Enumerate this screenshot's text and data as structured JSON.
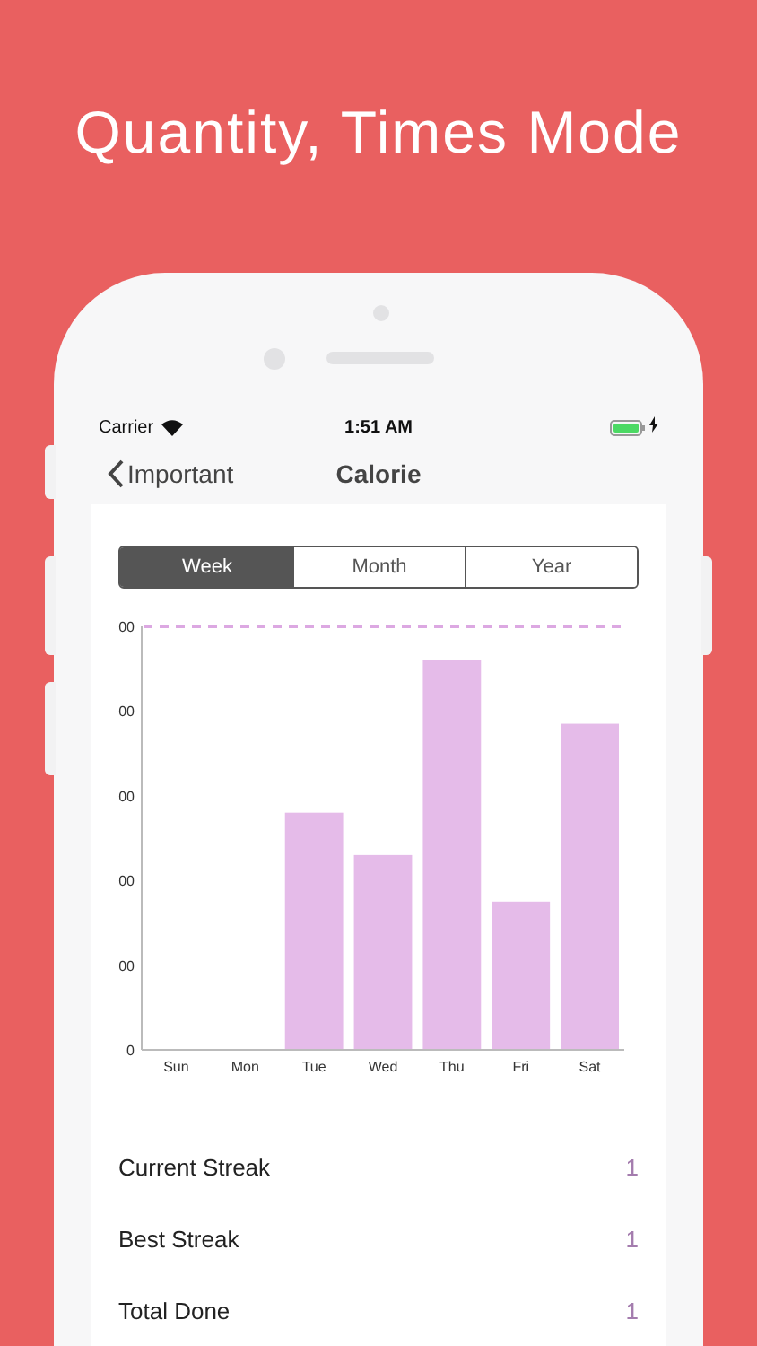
{
  "headline": "Quantity, Times Mode",
  "status_bar": {
    "carrier": "Carrier",
    "time": "1:51 AM",
    "charging": true
  },
  "nav": {
    "back": "Important",
    "title": "Calorie"
  },
  "tabs": [
    {
      "label": "Week",
      "selected": true
    },
    {
      "label": "Month",
      "selected": false
    },
    {
      "label": "Year",
      "selected": false
    }
  ],
  "chart": {
    "y_labels": [
      "00",
      "00",
      "00",
      "00",
      "00",
      "0"
    ],
    "x_labels": [
      "Sun",
      "Mon",
      "Tue",
      "Wed",
      "Thu",
      "Fri",
      "Sat"
    ]
  },
  "stats": [
    {
      "label": "Current Streak",
      "value": "1"
    },
    {
      "label": "Best Streak",
      "value": "1"
    },
    {
      "label": "Total Done",
      "value": "1"
    }
  ]
}
